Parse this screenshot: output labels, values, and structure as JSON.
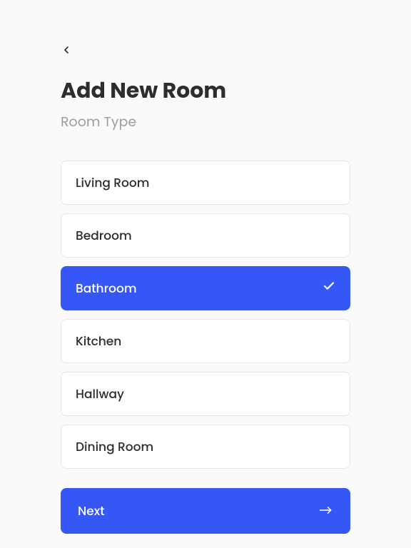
{
  "header": {
    "title": "Add New Room",
    "subtitle": "Room Type"
  },
  "options": [
    {
      "label": "Living Room",
      "selected": false
    },
    {
      "label": "Bedroom",
      "selected": false
    },
    {
      "label": "Bathroom",
      "selected": true
    },
    {
      "label": "Kitchen",
      "selected": false
    },
    {
      "label": "Hallway",
      "selected": false
    },
    {
      "label": "Dining Room",
      "selected": false
    }
  ],
  "footer": {
    "next_label": "Next"
  },
  "colors": {
    "accent": "#3457f5",
    "text_primary": "#2d2d2d",
    "text_secondary": "#9e9e9e",
    "border": "#e8e8e8",
    "background": "#fafafa"
  }
}
